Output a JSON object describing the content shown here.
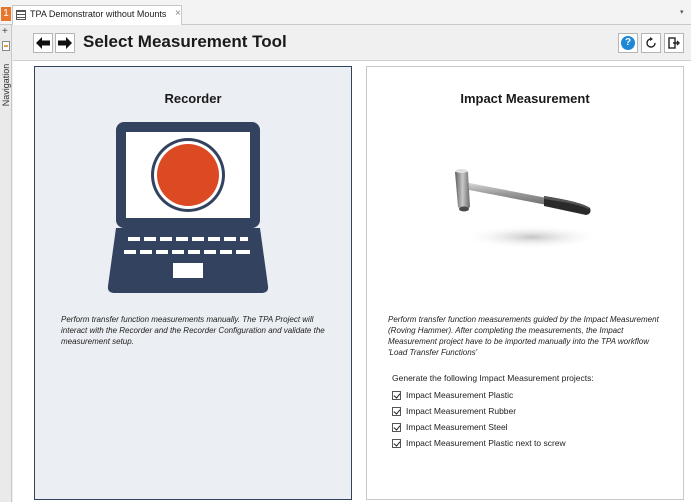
{
  "tab": {
    "index": "1",
    "title": "TPA Demonstrator without Mounts",
    "close": "×",
    "dropdown": "▾"
  },
  "nav": {
    "add": "+",
    "label": "Navigation"
  },
  "header": {
    "title": "Select Measurement Tool",
    "help": "?"
  },
  "recorder": {
    "title": "Recorder",
    "description": "Perform transfer function measurements manually. The TPA Project will interact with the Recorder and the Recorder Configuration and validate the measurement setup."
  },
  "impact": {
    "title": "Impact Measurement",
    "description": "Perform transfer function measurements guided by the Impact Measurement (Roving Hammer). After completing the measurements, the Impact Measurement project have to be imported manually into the TPA workflow 'Load Transfer Functions'",
    "projects_heading": "Generate the following Impact Measurement projects:",
    "projects": [
      {
        "label": "Impact Measurement Plastic",
        "checked": true
      },
      {
        "label": "Impact Measurement Rubber",
        "checked": true
      },
      {
        "label": "Impact Measurement Steel",
        "checked": true
      },
      {
        "label": "Impact Measurement Plastic next to screw",
        "checked": true
      }
    ]
  },
  "colors": {
    "accent_orange": "#e8762d",
    "laptop_navy": "#33435f",
    "record_red": "#dc4a24",
    "help_blue": "#1e87d6"
  }
}
